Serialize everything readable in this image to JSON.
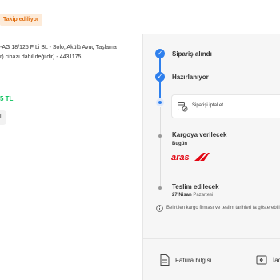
{
  "header": {
    "badge": "Takip ediliyor"
  },
  "product": {
    "name_line1": "-AG 18/125 F Li BL - Solo, Akülü Avuç Taşlama",
    "name_line2": "r) cihazı dahil değildir) - 4431175",
    "price": "5 TL",
    "quantity": "l"
  },
  "timeline": {
    "steps": [
      {
        "label": "Sipariş alındı",
        "status": "done"
      },
      {
        "label": "Hazırlanıyor",
        "status": "done"
      },
      {
        "label": "Siparişi iptal et",
        "status": "current-action"
      },
      {
        "label": "Kargoya verilecek",
        "sub": "Bugün",
        "carrier": "aras",
        "status": "pending"
      },
      {
        "label": "Teslim edilecek",
        "date_bold": "27 Nisan",
        "date_light": "Pazartesi",
        "status": "pending"
      }
    ],
    "info": "Belirtilen kargo firması ve teslim tarihleri ta gösterebilir."
  },
  "footer": {
    "invoice": "Fatura bilgisi",
    "return": "İad"
  },
  "colors": {
    "accent": "#2f80ed",
    "price": "#0bc15c",
    "badge_bg": "#fdebd9",
    "badge_text": "#e06b0b",
    "aras_red": "#e30613"
  }
}
